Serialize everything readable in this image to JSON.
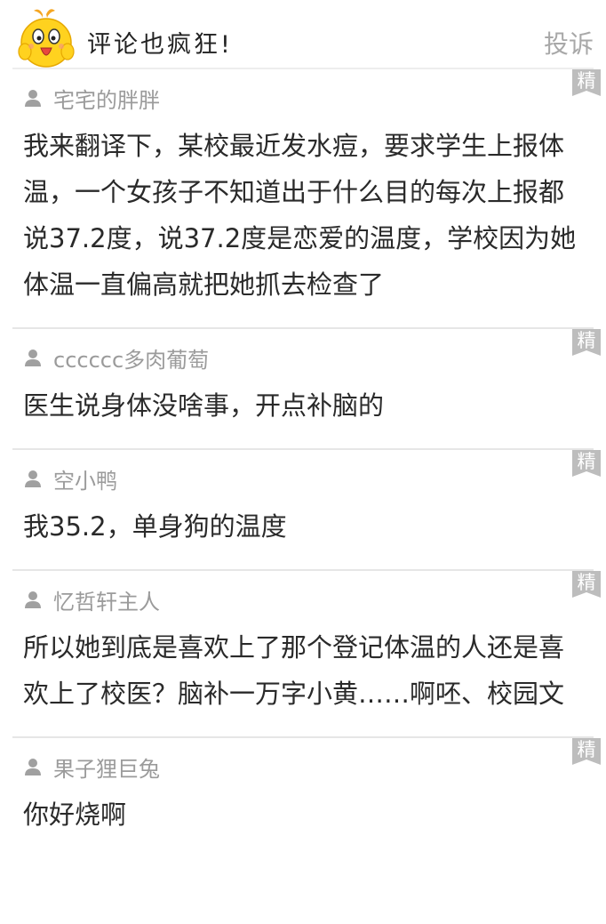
{
  "header": {
    "title": "评论也疯狂!",
    "report_label": "投诉"
  },
  "badge_label": "精",
  "comments": [
    {
      "author": "宅宅的胖胖",
      "text": "我来翻译下，某校最近发水痘，要求学生上报体温，一个女孩子不知道出于什么目的每次上报都说37.2度，说37.2度是恋爱的温度，学校因为她体温一直偏高就把她抓去检查了"
    },
    {
      "author": "cccccc多肉葡萄",
      "text": "医生说身体没啥事，开点补脑的"
    },
    {
      "author": "空小鸭",
      "text": "我35.2，单身狗的温度"
    },
    {
      "author": "忆哲轩主人",
      "text": "所以她到底是喜欢上了那个登记体温的人还是喜欢上了校医？脑补一万字小黄……啊呸、校园文"
    },
    {
      "author": "果子狸巨兔",
      "text": "你好烧啊"
    }
  ]
}
